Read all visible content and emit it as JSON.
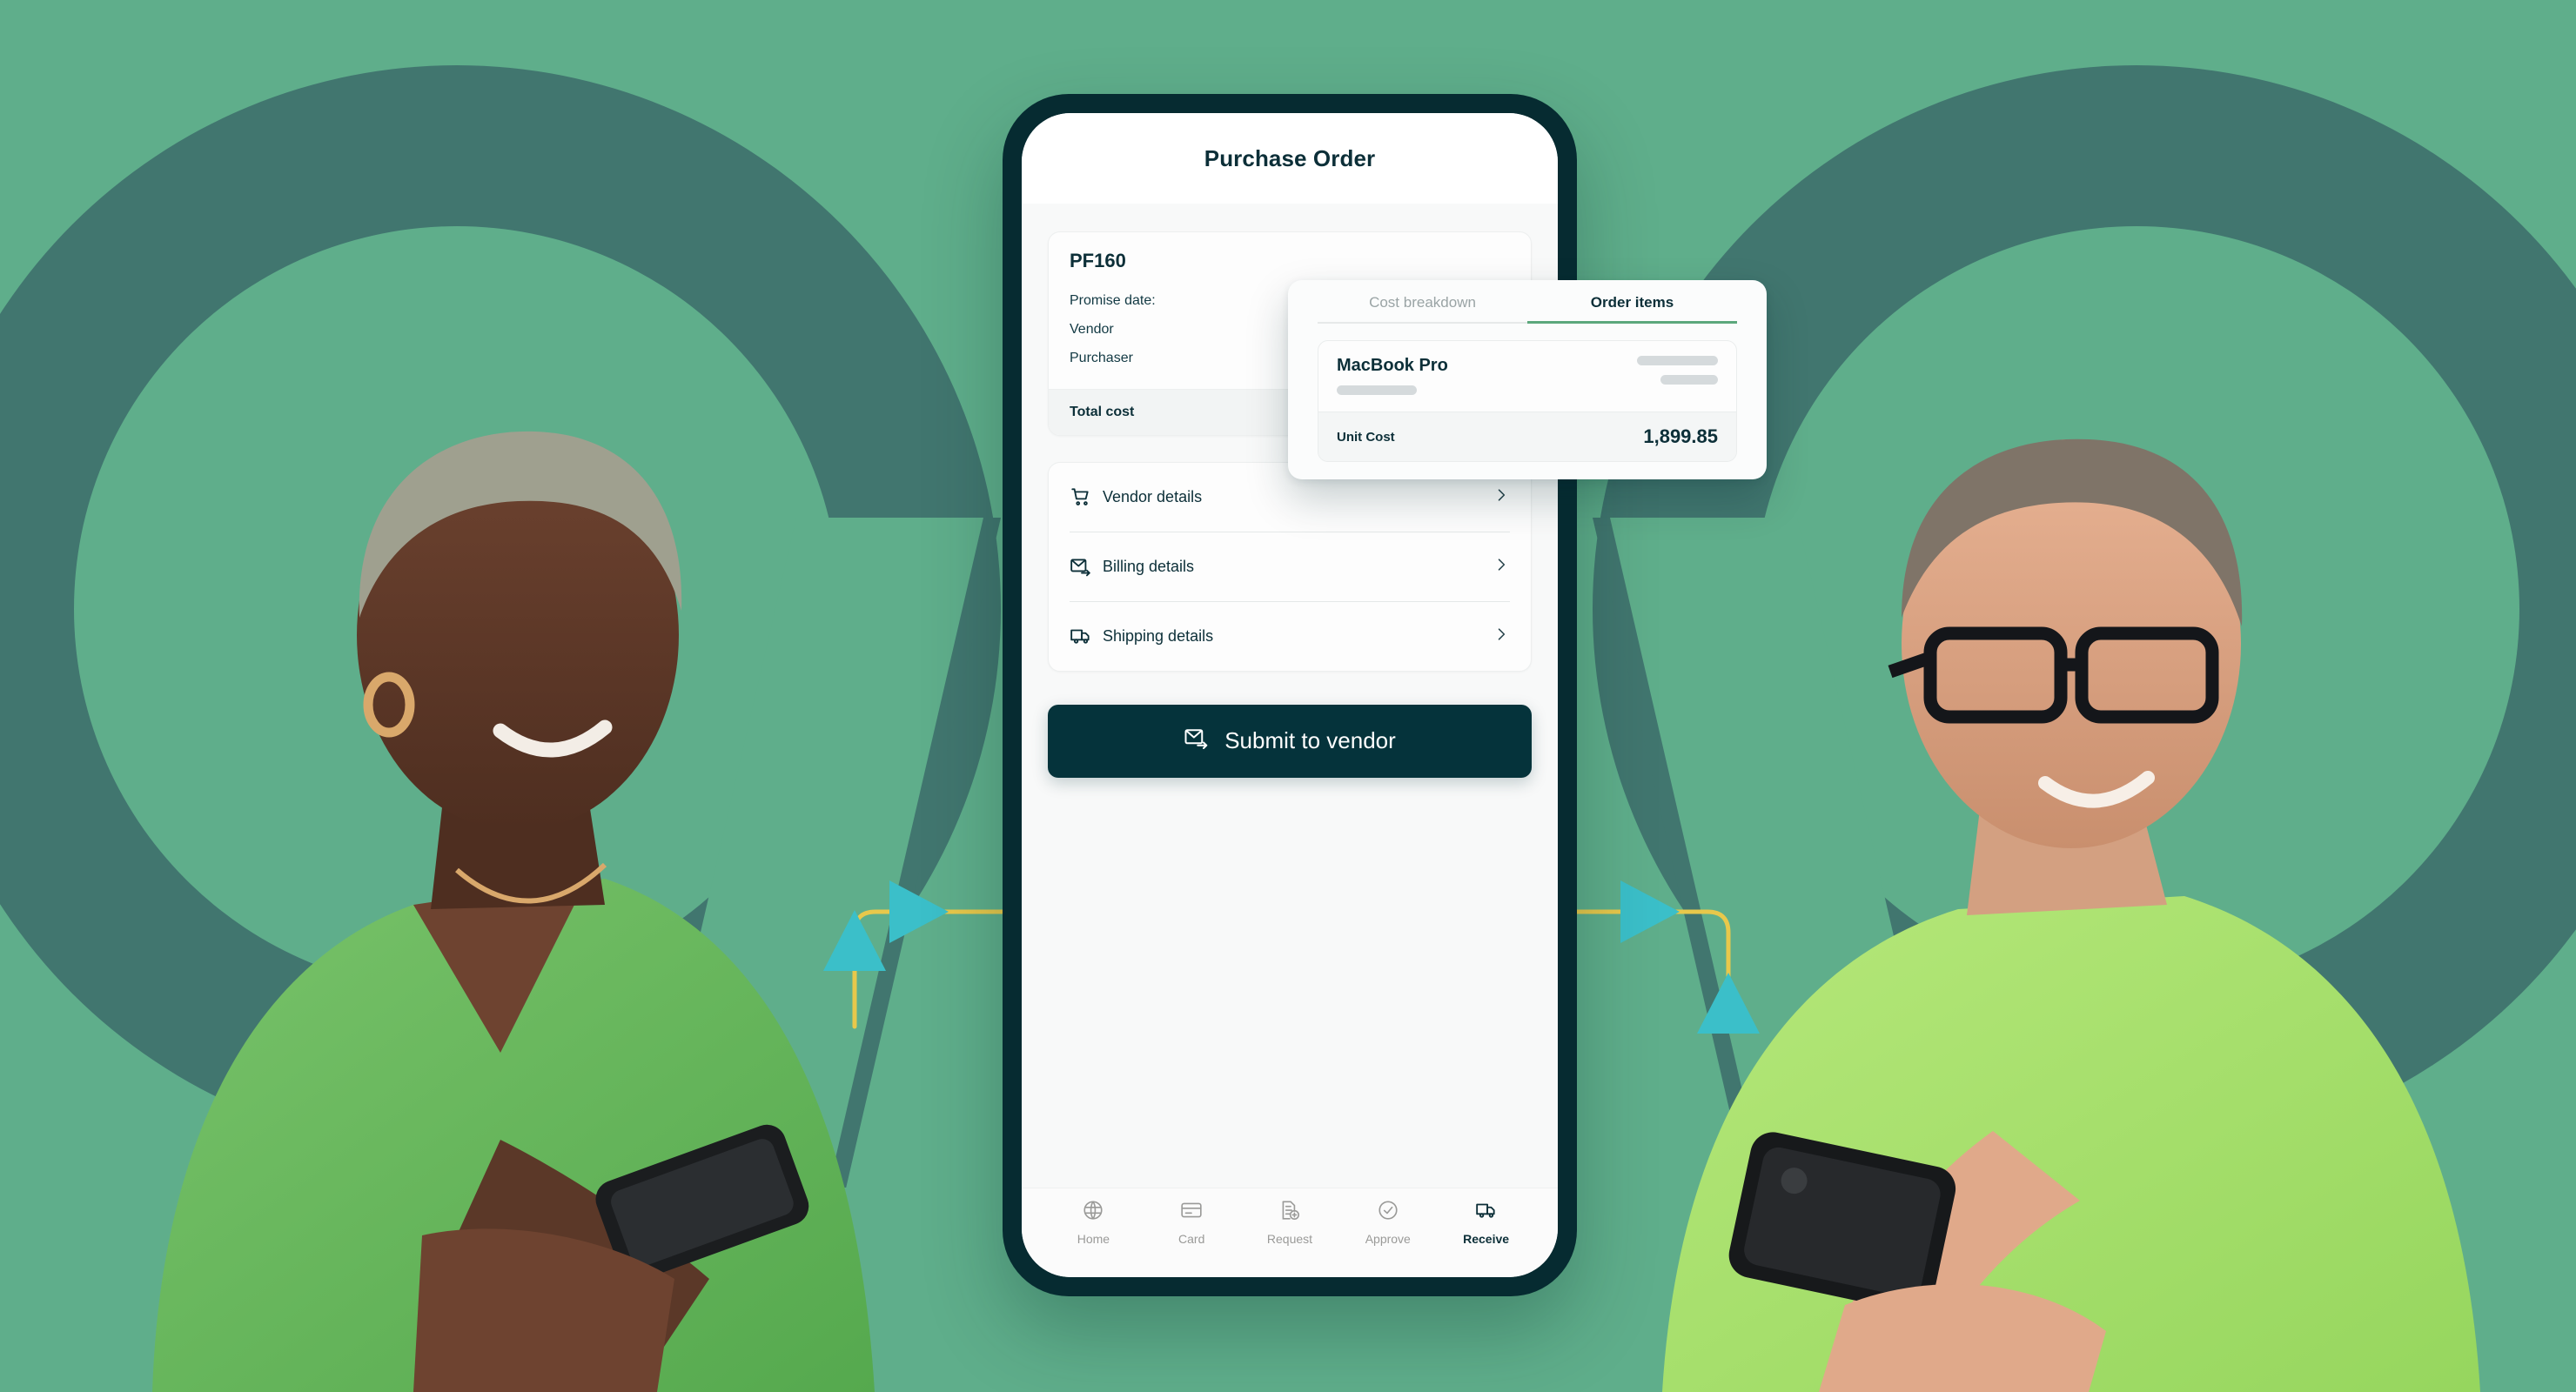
{
  "theme": {
    "bg_green": "#5FAE8B",
    "bg_dark_teal": "#41766F",
    "phone_frame": "#062B31",
    "accent_dark": "#05333B",
    "tab_underline_green": "#5CA87C",
    "connector_line": "#E8C84B",
    "connector_arrow": "#3BBFC9"
  },
  "phone": {
    "title": "Purchase Order",
    "summary": {
      "order_id": "PF160",
      "rows": [
        {
          "label": "Promise date:"
        },
        {
          "label": "Vendor"
        },
        {
          "label": "Purchaser"
        }
      ],
      "total_label": "Total cost"
    },
    "links": [
      {
        "icon": "shopping-cart-icon",
        "label": "Vendor details",
        "chevron": "chevron-right-icon"
      },
      {
        "icon": "envelope-send-icon",
        "label": "Billing details",
        "chevron": "chevron-right-icon"
      },
      {
        "icon": "delivery-truck-icon",
        "label": "Shipping details",
        "chevron": "chevron-right-icon"
      }
    ],
    "submit": {
      "icon": "envelope-send-icon",
      "label": "Submit to vendor"
    },
    "nav": [
      {
        "icon": "globe-icon",
        "label": "Home",
        "active": false
      },
      {
        "icon": "credit-card-icon",
        "label": "Card",
        "active": false
      },
      {
        "icon": "document-plus-icon",
        "label": "Request",
        "active": false
      },
      {
        "icon": "check-circle-icon",
        "label": "Approve",
        "active": false
      },
      {
        "icon": "delivery-truck-icon",
        "label": "Receive",
        "active": true
      }
    ]
  },
  "popup": {
    "tabs": [
      {
        "label": "Cost breakdown",
        "active": false
      },
      {
        "label": "Order items",
        "active": true
      }
    ],
    "item": {
      "name": "MacBook Pro",
      "unit_cost_label": "Unit Cost",
      "unit_cost_value": "1,899.85"
    }
  }
}
